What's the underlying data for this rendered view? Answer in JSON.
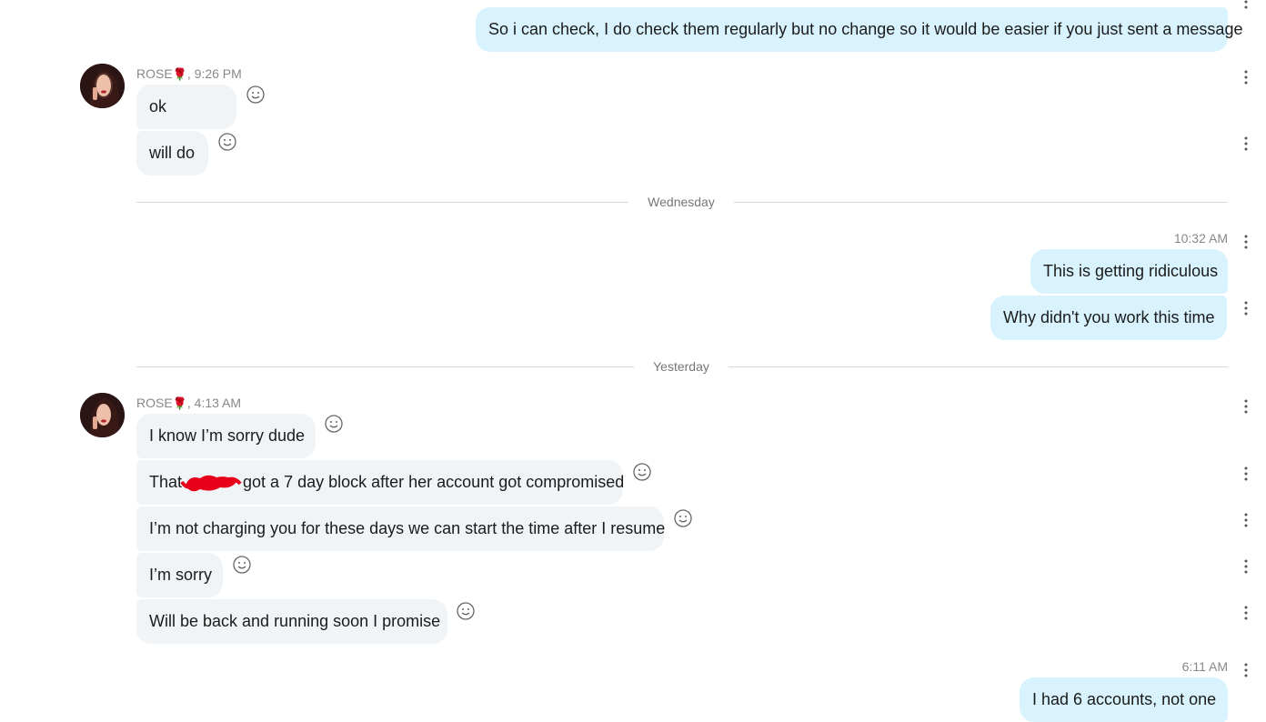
{
  "conversation": {
    "contact_name": "ROSE",
    "contact_emoji_icon": "rose-icon",
    "accent_outgoing": "#d8f3fe",
    "accent_incoming": "#f1f4f7"
  },
  "messages": {
    "m0": {
      "text": "So i can check, I do check them regularly but no change so it would be easier if you just sent a message"
    },
    "g1": {
      "sender": "ROSE",
      "time": ", 9:26 PM"
    },
    "m1": {
      "text": "ok"
    },
    "m2": {
      "text": "will do"
    },
    "sep1": {
      "label": "Wednesday"
    },
    "g2": {
      "time": "10:32 AM"
    },
    "m3": {
      "text": "This is getting ridiculous"
    },
    "m4": {
      "text": "Why didn't you work this time"
    },
    "sep2": {
      "label": "Yesterday"
    },
    "g3": {
      "sender": "ROSE",
      "time": ", 4:13 AM"
    },
    "m5": {
      "text": "I know I’m sorry dude"
    },
    "m6": {
      "text_before": "That ",
      "text_after": "got a 7 day block after her account got compromised"
    },
    "m7": {
      "text": "I’m not charging you for these days we can start the time after I resume"
    },
    "m8": {
      "text": "I’m sorry"
    },
    "m9": {
      "text": "Will be back and running soon I promise"
    },
    "g4": {
      "time": "6:11 AM"
    },
    "m10": {
      "text": "I had 6 accounts, not one"
    }
  }
}
